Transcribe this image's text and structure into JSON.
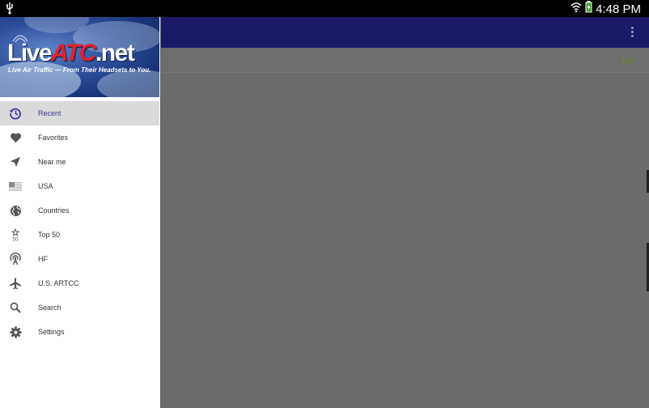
{
  "status_bar": {
    "time": "4:48 PM"
  },
  "app_bar": {
    "overflow_icon": "more-vert-icon"
  },
  "sub_bar": {
    "up_label": "Up"
  },
  "banner": {
    "logo_live": "Live",
    "logo_atc": "ATC",
    "logo_net": ".net",
    "tagline": "Live Air Traffic — From Their Headsets to You."
  },
  "nav": {
    "items": [
      {
        "label": "Recent",
        "icon": "history-icon",
        "active": true
      },
      {
        "label": "Favorites",
        "icon": "heart-icon"
      },
      {
        "label": "Near me",
        "icon": "navigation-arrow-icon"
      },
      {
        "label": "USA",
        "icon": "us-flag-icon"
      },
      {
        "label": "Countries",
        "icon": "globe-icon"
      },
      {
        "label": "Top 50",
        "icon": "top-50-icon"
      },
      {
        "label": "HF",
        "icon": "antenna-icon"
      },
      {
        "label": "U.S. ARTCC",
        "icon": "airplane-icon"
      },
      {
        "label": "Search",
        "icon": "search-icon"
      },
      {
        "label": "Settings",
        "icon": "gear-icon"
      }
    ]
  },
  "colors": {
    "app_bar": "#1b1a69",
    "active_label": "#3d3d9a",
    "up_link": "#6a8a2a",
    "logo_atc": "#e8202a"
  }
}
